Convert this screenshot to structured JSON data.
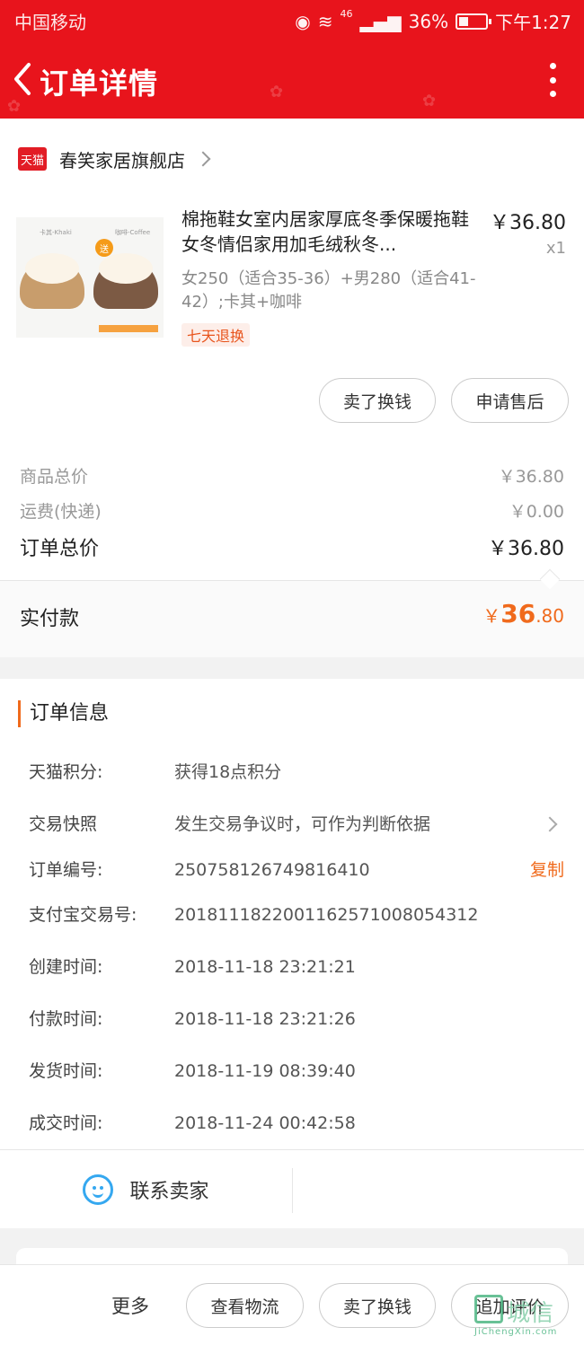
{
  "status_bar": {
    "carrier": "中国移动",
    "network": "46",
    "battery": "36%",
    "time": "下午1:27"
  },
  "nav": {
    "title": "订单详情"
  },
  "shop": {
    "logo_text": "天猫",
    "name": "春笑家居旗舰店"
  },
  "product": {
    "image_labels": [
      "卡其-Khaki",
      "咖啡-Coffee"
    ],
    "image_tag": "送",
    "title": "棉拖鞋女室内居家厚底冬季保暖拖鞋女冬情侣家用加毛绒秋冬...",
    "price": "￥36.80",
    "qty": "x1",
    "spec": "女250（适合35-36）+男280（适合41-42）;卡其+咖啡",
    "badge": "七天退换"
  },
  "product_actions": {
    "sell_exchange": "卖了换钱",
    "after_sale": "申请售后"
  },
  "fees": {
    "goods_total_label": "商品总价",
    "goods_total": "￥36.80",
    "shipping_label": "运费(快递)",
    "shipping": "￥0.00",
    "order_total_label": "订单总价",
    "order_total": "￥36.80"
  },
  "paid": {
    "label": "实付款",
    "currency": "￥",
    "integer": "36",
    "decimal": ".80"
  },
  "order_info": {
    "title": "订单信息",
    "rows": [
      {
        "key": "天猫积分:",
        "value": "获得18点积分"
      },
      {
        "key": "交易快照",
        "value": "发生交易争议时，可作为判断依据"
      },
      {
        "key": "订单编号:",
        "value": "250758126749816410",
        "action": "复制"
      },
      {
        "key": "支付宝交易号:",
        "value": "2018111822001162571008054312"
      },
      {
        "key": "创建时间:",
        "value": "2018-11-18 23:21:21"
      },
      {
        "key": "付款时间:",
        "value": "2018-11-18 23:21:26"
      },
      {
        "key": "发货时间:",
        "value": "2018-11-19 08:39:40"
      },
      {
        "key": "成交时间:",
        "value": "2018-11-24 00:42:58"
      }
    ],
    "contact_seller": "联系卖家"
  },
  "bottom_bar": {
    "more": "更多",
    "logistics": "查看物流",
    "sell_exchange": "卖了换钱",
    "review": "追加评价"
  },
  "watermark": {
    "text": "城信",
    "url": "JiChengXin.com"
  },
  "colors": {
    "header_red": "#e8141c",
    "accent_orange": "#f06a1c",
    "contact_blue": "#35a8f0"
  }
}
